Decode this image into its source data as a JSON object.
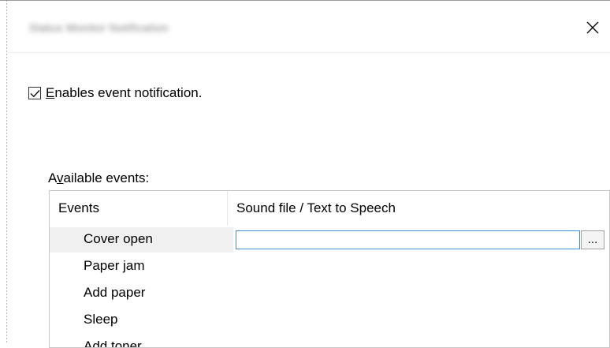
{
  "window": {
    "title": "Status Monitor Notification",
    "close_icon": "close-icon"
  },
  "notification": {
    "checked": true,
    "label_accel": "E",
    "label_rest": "nables event notification."
  },
  "events_section": {
    "label_pre": "A",
    "label_accel": "v",
    "label_rest": "ailable events:"
  },
  "table": {
    "headers": [
      "Events",
      "Sound file / Text to Speech"
    ],
    "rows": [
      {
        "event": "Cover open",
        "sound": ""
      },
      {
        "event": "Paper jam"
      },
      {
        "event": "Add paper"
      },
      {
        "event": "Sleep"
      },
      {
        "event": "Add toner"
      }
    ],
    "selected_row": 0,
    "browse_label": "..."
  },
  "colors": {
    "input_focus": "#3b8fd6",
    "selection_bg": "#f0f0f0"
  }
}
